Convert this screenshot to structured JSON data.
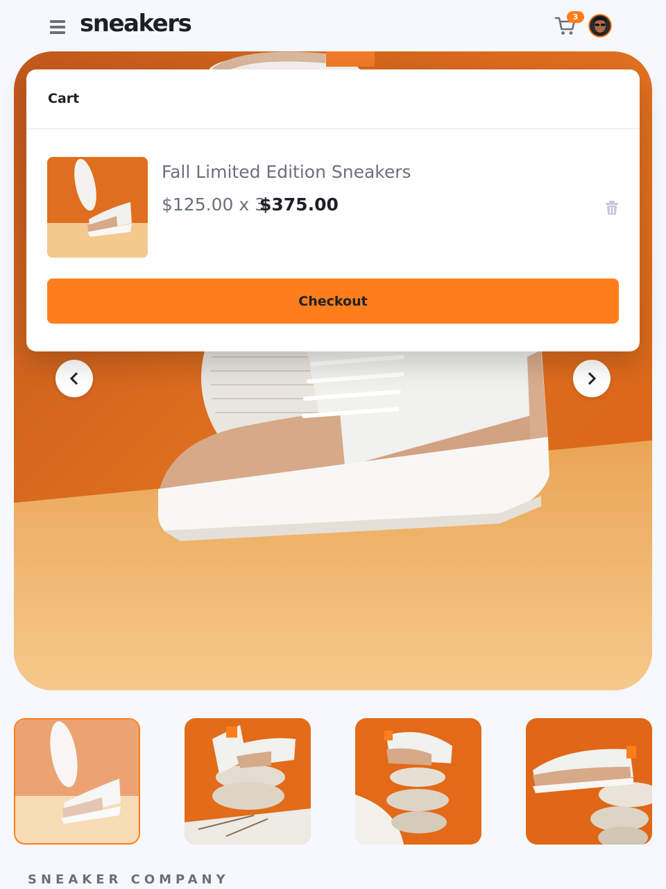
{
  "header": {
    "logo": "sneakers",
    "cart_count": "3",
    "icons": {
      "menu": "menu-icon",
      "cart": "cart-icon"
    }
  },
  "gallery": {
    "prev_icon": "chevron-left-icon",
    "next_icon": "chevron-right-icon",
    "thumbnails": [
      "thumbnail-1",
      "thumbnail-2",
      "thumbnail-3",
      "thumbnail-4"
    ],
    "active_thumbnail": 1
  },
  "cart": {
    "title": "Cart",
    "item": {
      "name": "Fall Limited Edition Sneakers",
      "price": "$125.00 x 3",
      "total": "$375.00"
    },
    "delete_icon": "trash-icon",
    "checkout_label": "Checkout"
  },
  "product": {
    "brand": "SNEAKER COMPANY"
  },
  "colors": {
    "accent": "#ff7e1b",
    "text_dark": "#1d2026",
    "text_grey": "#69707d",
    "background": "#f6f8fd"
  }
}
